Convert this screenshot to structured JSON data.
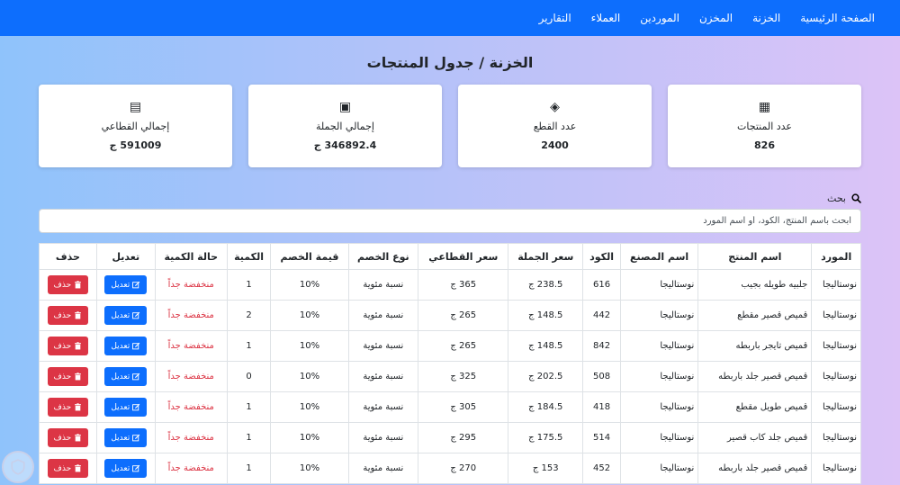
{
  "nav": [
    "الصفحة الرئيسية",
    "الخزنة",
    "المخزن",
    "الموردين",
    "العملاء",
    "التقارير"
  ],
  "page_title": "الخزنة / جدول المنتجات",
  "cards": [
    {
      "icon": "boxes-icon",
      "glyph": "▦",
      "label": "عدد المنتجات",
      "value": "826"
    },
    {
      "icon": "layers-icon",
      "glyph": "◈",
      "label": "عدد القطع",
      "value": "2400"
    },
    {
      "icon": "money-icon",
      "glyph": "▣",
      "label": "إجمالي الجملة",
      "value": "346892.4 ج"
    },
    {
      "icon": "cash-register-icon",
      "glyph": "▤",
      "label": "إجمالي القطاعي",
      "value": "591009 ج"
    }
  ],
  "search": {
    "label": "بحث",
    "placeholder": "ابحث باسم المنتج، الكود، أو اسم المورد"
  },
  "table": {
    "headers": [
      "المورد",
      "اسم المنتج",
      "اسم المصنع",
      "الكود",
      "سعر الجملة",
      "سعر القطاعي",
      "نوع الخصم",
      "قيمة الخصم",
      "الكمية",
      "حالة الكمية",
      "تعديل",
      "حذف"
    ],
    "edit_label": "تعديل",
    "delete_label": "حذف",
    "rows": [
      [
        "نوستاليجا",
        "جلبيه طويله بجيب",
        "نوستاليجا",
        "616",
        "238.5 ج",
        "365 ج",
        "نسبة مئوية",
        "10%",
        "1",
        "منخفضة جداً"
      ],
      [
        "نوستاليجا",
        "قميص قصير مقطع",
        "نوستاليجا",
        "442",
        "148.5 ج",
        "265 ج",
        "نسبة مئوية",
        "10%",
        "2",
        "منخفضة جداً"
      ],
      [
        "نوستاليجا",
        "قميص تايجر باربطه",
        "نوستاليجا",
        "842",
        "148.5 ج",
        "265 ج",
        "نسبة مئوية",
        "10%",
        "1",
        "منخفضة جداً"
      ],
      [
        "نوستاليجا",
        "قميص قصير جلد باربطه",
        "نوستاليجا",
        "508",
        "202.5 ج",
        "325 ج",
        "نسبة مئوية",
        "10%",
        "0",
        "منخفضة جداً"
      ],
      [
        "نوستاليجا",
        "قميص طويل مقطع",
        "نوستاليجا",
        "418",
        "184.5 ج",
        "305 ج",
        "نسبة مئوية",
        "10%",
        "1",
        "منخفضة جداً"
      ],
      [
        "نوستاليجا",
        "قميص جلد كاب قصير",
        "نوستاليجا",
        "514",
        "175.5 ج",
        "295 ج",
        "نسبة مئوية",
        "10%",
        "1",
        "منخفضة جداً"
      ],
      [
        "نوستاليجا",
        "قميص قصير جلد باربطه",
        "نوستاليجا",
        "452",
        "153 ج",
        "270 ج",
        "نسبة مئوية",
        "10%",
        "1",
        "منخفضة جداً"
      ]
    ]
  }
}
